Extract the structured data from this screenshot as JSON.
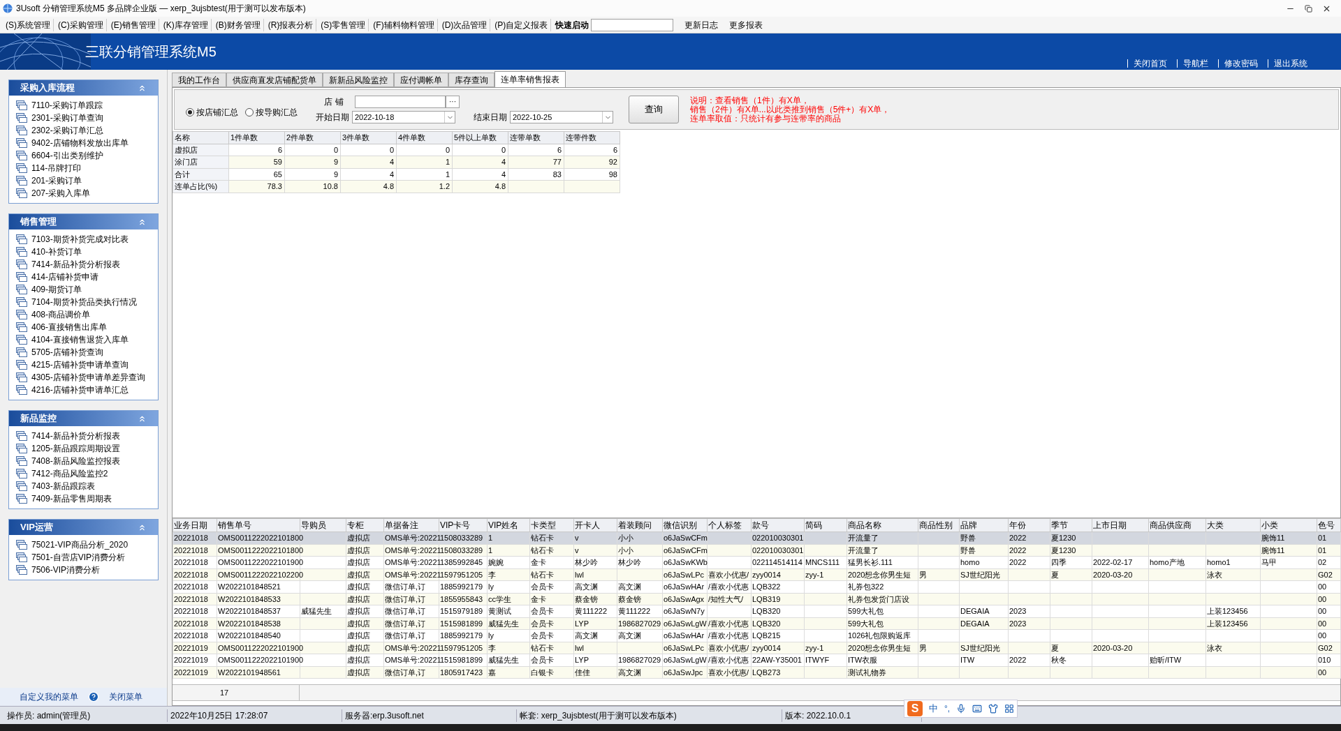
{
  "window": {
    "title": "3Usoft 分销管理系统M5 多品牌企业版 — xerp_3ujsbtest(用于测可以发布版本)"
  },
  "menu": {
    "items": [
      "(S)系统管理",
      "(C)采购管理",
      "(E)销售管理",
      "(K)库存管理",
      "(B)财务管理",
      "(R)报表分析",
      "(S)零售管理",
      "(F)辅料物料管理",
      "(D)次品管理",
      "(P)自定义报表"
    ],
    "quick_launch_label": "快速启动",
    "links": [
      "更新日志",
      "更多报表"
    ]
  },
  "banner": {
    "title": "三联分销管理系统M5",
    "links": [
      "关闭首页",
      "导航栏",
      "修改密码",
      "退出系统"
    ]
  },
  "sidebar": {
    "sections": [
      {
        "title": "采购入库流程",
        "expanded": true,
        "items": [
          "7110-采购订单跟踪",
          "2301-采购订单查询",
          "2302-采购订单汇总",
          "9402-店铺物料发放出库单",
          "6604-引出类别维护",
          "114-吊牌打印",
          "201-采购订单",
          "207-采购入库单"
        ]
      },
      {
        "title": "销售管理",
        "expanded": true,
        "items": [
          "7103-期货补货完成对比表",
          "410-补货订单",
          "7414-新品补货分析报表",
          "414-店铺补货申请",
          "409-期货订单",
          "7104-期货补货品类执行情况",
          "408-商品调价单",
          "406-直接销售出库单",
          "4104-直接销售退货入库单",
          "5705-店铺补货查询",
          "4215-店铺补货申请单查询",
          "4305-店铺补货申请单差异查询",
          "4216-店铺补货申请单汇总"
        ]
      },
      {
        "title": "新品监控",
        "expanded": true,
        "items": [
          "7414-新品补货分析报表",
          "1205-新品跟踪周期设置",
          "7408-新品风险监控报表",
          "7412-商品风险监控2",
          "7403-新品跟踪表",
          "7409-新品零售周期表"
        ]
      },
      {
        "title": "VIP运营",
        "expanded": true,
        "items": [
          "75021-VIP商品分析_2020",
          "7501-自营店VIP消费分析",
          "7506-VIP消费分析"
        ]
      }
    ],
    "footer": {
      "custom_menu": "自定义我的菜单",
      "close_menu": "关闭菜单"
    }
  },
  "tabs": [
    {
      "label": "我的工作台",
      "selected": false
    },
    {
      "label": "供应商直发店铺配货单",
      "selected": false
    },
    {
      "label": "新新品风险监控",
      "selected": false
    },
    {
      "label": "应付调帐单",
      "selected": false
    },
    {
      "label": "库存查询",
      "selected": false
    },
    {
      "label": "连单率销售报表",
      "selected": true
    }
  ],
  "query": {
    "modes": [
      {
        "label": "按店铺汇总",
        "selected": true
      },
      {
        "label": "按导购汇总",
        "selected": false
      }
    ],
    "store": {
      "label": "店 铺",
      "browse": "···"
    },
    "start_date": {
      "label": "开始日期",
      "value": "2022-10-18"
    },
    "end_date": {
      "label": "结束日期",
      "value": "2022-10-25"
    },
    "button": "查询",
    "note": [
      "说明：查看销售（1件）有X单，",
      "销售（2件）有X单...以此类推到销售（5件+）有X单，",
      "连单率取值：只统计有参与连带率的商品"
    ]
  },
  "summary_table": {
    "columns": [
      "名称",
      "1件单数",
      "2件单数",
      "3件单数",
      "4件单数",
      "5件以上单数",
      "连带单数",
      "连带件数"
    ],
    "rows": [
      [
        "虚拟店",
        "6",
        "0",
        "0",
        "0",
        "0",
        "6",
        "6"
      ],
      [
        "涂门店",
        "59",
        "9",
        "4",
        "1",
        "4",
        "77",
        "92"
      ],
      [
        "合计",
        "65",
        "9",
        "4",
        "1",
        "4",
        "83",
        "98"
      ],
      [
        "连单占比(%)",
        "78.3",
        "10.8",
        "4.8",
        "1.2",
        "4.8",
        null,
        null
      ]
    ]
  },
  "detail_table": {
    "columns": [
      "业务日期",
      "销售单号",
      "导购员",
      "专柜",
      "单据备注",
      "VIP卡号",
      "VIP姓名",
      "卡类型",
      "开卡人",
      "着装顾问",
      "微信识别",
      "个人标签",
      "款号",
      "简码",
      "商品名称",
      "商品性别",
      "品牌",
      "年份",
      "季节",
      "上市日期",
      "商品供应商",
      "大类",
      "小类",
      "色号"
    ],
    "rows": [
      {
        "selected": true,
        "cells": [
          "20221018",
          "OMS0011222022101800",
          null,
          "虚拟店",
          "OMS单号:20221",
          "1508033289",
          "1",
          "钻石卡",
          "v",
          "小小",
          "o6JaSwCFm",
          null,
          "022010030301",
          null,
          "开流量了",
          null,
          "野兽",
          "2022",
          "夏1230",
          null,
          null,
          null,
          "腕饰11",
          "01"
        ]
      },
      {
        "selected": false,
        "cells": [
          "20221018",
          "OMS0011222022101800",
          null,
          "虚拟店",
          "OMS单号:20221",
          "1508033289",
          "1",
          "钻石卡",
          "v",
          "小小",
          "o6JaSwCFm",
          null,
          "022010030301",
          null,
          "开流量了",
          null,
          "野兽",
          "2022",
          "夏1230",
          null,
          null,
          null,
          "腕饰11",
          "01"
        ]
      },
      {
        "selected": false,
        "cells": [
          "20221018",
          "OMS0011222022101900",
          null,
          "虚拟店",
          "OMS单号:20221",
          "1385992845",
          "婉婉",
          "金卡",
          "林少吟",
          "林少吟",
          "o6JaSwKWb",
          null,
          "022114514114",
          "MNCS111",
          "猛男长衫.111",
          null,
          "homo",
          "2022",
          "四季",
          "2022-02-17",
          "homo产地",
          "homo1",
          "马甲",
          "02"
        ]
      },
      {
        "selected": false,
        "cells": [
          "20221018",
          "OMS0011222022102200",
          null,
          "虚拟店",
          "OMS单号:20221",
          "1597951205",
          "李",
          "钻石卡",
          "lwl",
          null,
          "o6JaSwLPc",
          "喜欢小优惠/",
          "zyy0014",
          "zyy-1",
          "2020想念你男生短",
          "男",
          "SJ世纪阳光",
          null,
          "夏",
          "2020-03-20",
          null,
          "泳衣",
          null,
          "G02"
        ]
      },
      {
        "selected": false,
        "cells": [
          "20221018",
          "W2022101848521",
          null,
          "虚拟店",
          "微信订单,订",
          "1885992179",
          "ly",
          "会员卡",
          "高文渊",
          "高文渊",
          "o6JaSwHAr",
          "/喜欢小优惠",
          "LQB322",
          null,
          "礼券包322",
          null,
          null,
          null,
          null,
          null,
          null,
          null,
          null,
          "00"
        ]
      },
      {
        "selected": false,
        "cells": [
          "20221018",
          "W2022101848533",
          null,
          "虚拟店",
          "微信订单,订",
          "1855955843",
          "cc学生",
          "金卡",
          "蔡金镑",
          "蔡金镑",
          "o6JaSwAgx",
          "/知性大气/",
          "LQB319",
          null,
          "礼券包发货门店设",
          null,
          null,
          null,
          null,
          null,
          null,
          null,
          null,
          "00"
        ]
      },
      {
        "selected": false,
        "cells": [
          "20221018",
          "W2022101848537",
          "威猛先生",
          "虚拟店",
          "微信订单,订",
          "1515979189",
          "黄测试",
          "会员卡",
          "黄111222",
          "黄111222",
          "o6JaSwN7y",
          null,
          "LQB320",
          null,
          "599大礼包",
          null,
          "DEGAIA",
          "2023",
          null,
          null,
          null,
          "上装123456",
          null,
          "00"
        ]
      },
      {
        "selected": false,
        "cells": [
          "20221018",
          "W2022101848538",
          null,
          "虚拟店",
          "微信订单,订",
          "1515981899",
          "威猛先生",
          "会员卡",
          "LYP",
          "1986827029",
          "o6JaSwLgW",
          "/喜欢小优惠",
          "LQB320",
          null,
          "599大礼包",
          null,
          "DEGAIA",
          "2023",
          null,
          null,
          null,
          "上装123456",
          null,
          "00"
        ]
      },
      {
        "selected": false,
        "cells": [
          "20221018",
          "W2022101848540",
          null,
          "虚拟店",
          "微信订单,订",
          "1885992179",
          "ly",
          "会员卡",
          "高文渊",
          "高文渊",
          "o6JaSwHAr",
          "/喜欢小优惠",
          "LQB215",
          null,
          "1026礼包限购返库",
          null,
          null,
          null,
          null,
          null,
          null,
          null,
          null,
          "00"
        ]
      },
      {
        "selected": false,
        "cells": [
          "20221019",
          "OMS0011222022101900",
          null,
          "虚拟店",
          "OMS单号:20221",
          "1597951205",
          "李",
          "钻石卡",
          "lwl",
          null,
          "o6JaSwLPc",
          "喜欢小优惠/",
          "zyy0014",
          "zyy-1",
          "2020想念你男生短",
          "男",
          "SJ世纪阳光",
          null,
          "夏",
          "2020-03-20",
          null,
          "泳衣",
          null,
          "G02"
        ]
      },
      {
        "selected": false,
        "cells": [
          "20221019",
          "OMS0011222022101900",
          null,
          "虚拟店",
          "OMS单号:20221",
          "1515981899",
          "威猛先生",
          "会员卡",
          "LYP",
          "1986827029",
          "o6JaSwLgW",
          "/喜欢小优惠",
          "22AW-Y35001",
          "ITWYF",
          "ITW衣服",
          null,
          "ITW",
          "2022",
          "秋冬",
          null,
          "贻昕/ITW",
          null,
          null,
          "010"
        ]
      },
      {
        "selected": false,
        "cells": [
          "20221019",
          "W2022101948561",
          null,
          "虚拟店",
          "微信订单,订",
          "1805917423",
          "嘉",
          "白银卡",
          "佳佳",
          "高文渊",
          "o6JaSwJpc",
          "喜欢小优惠/",
          "LQB273",
          null,
          "测试礼物券",
          null,
          null,
          null,
          null,
          null,
          null,
          null,
          null,
          "00"
        ]
      }
    ],
    "footer": {
      "count": "17"
    }
  },
  "status_bar": [
    "操作员: admin(管理员)",
    "2022年10月25日 17:28:07",
    "服务器:erp.3usoft.net",
    "帐套: xerp_3ujsbtest(用于测可以发布版本)",
    "版本: 2022.10.0.1"
  ],
  "ime_toolbar": {
    "logo": "S",
    "mode": "中",
    "punctuation": "°,"
  }
}
